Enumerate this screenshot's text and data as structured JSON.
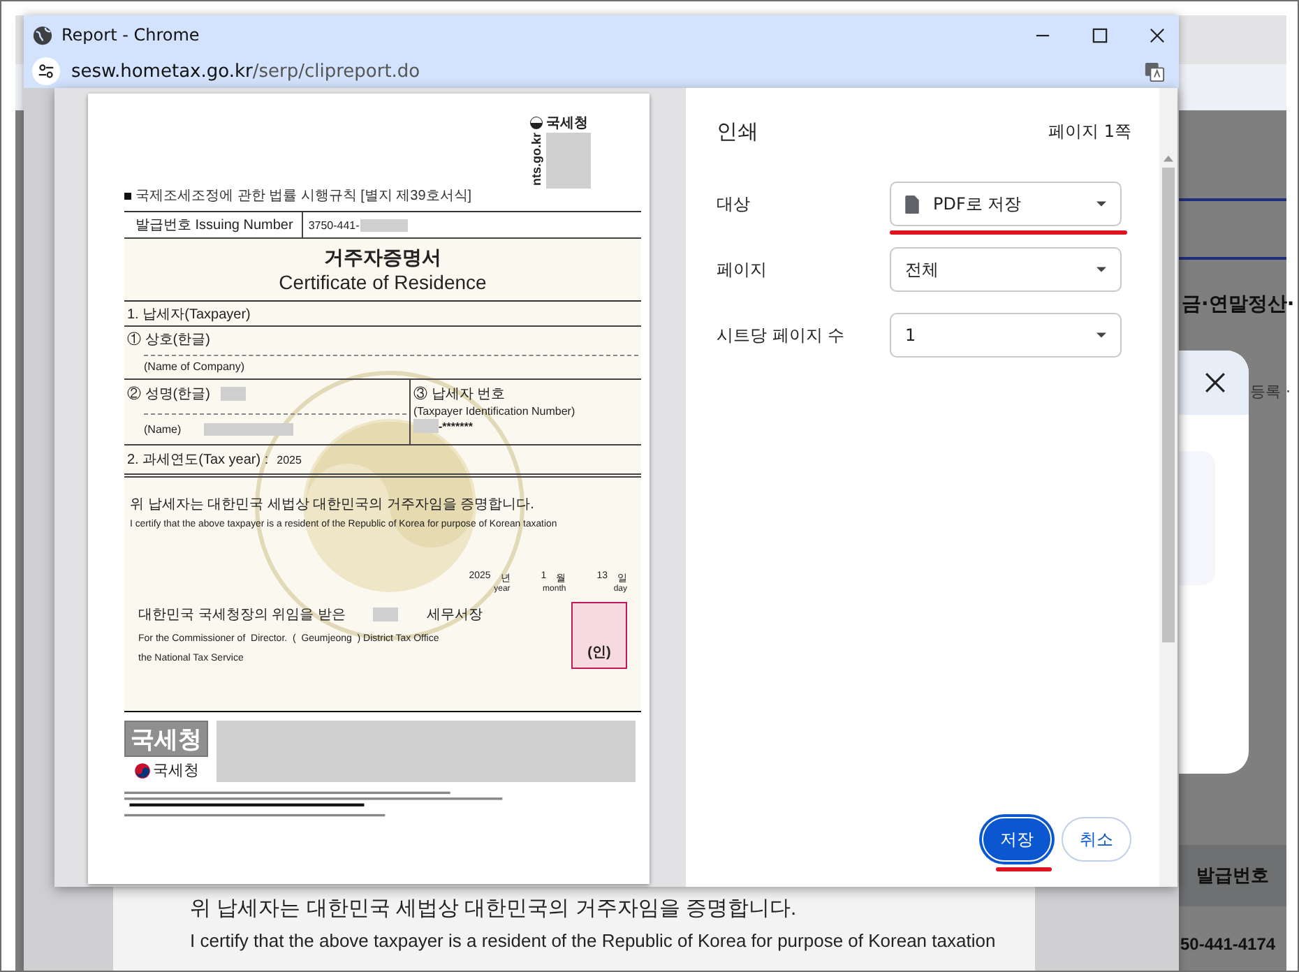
{
  "window": {
    "title": "Report - Chrome",
    "url_host": "sesw.hometax.go.kr",
    "url_path": "/serp/clipreport.do"
  },
  "document": {
    "agency_logo_text": "국세청",
    "site_text": "nts.go.kr",
    "form_reference": "국제조세조정에 관한 법률 시행규칙 [별지 제39호서식]",
    "issuing_label": "발급번호 Issuing Number",
    "issuing_number": "3750-441-",
    "title_ko": "거주자증명서",
    "title_en": "Certificate of Residence",
    "section_1": "1. 납세자(Taxpayer)",
    "company_label": "① 상호(한글)",
    "company_label_en": "(Name of Company)",
    "name_label": "② 성명(한글)",
    "name_label_en": "(Name)",
    "tin_label": "③ 납세자 번호",
    "tin_label_en": "(Taxpayer Identification Number)",
    "tin_value": "-*******",
    "section_2": "2. 과세연도(Tax year) :",
    "tax_year": "2025",
    "statement_ko": "위 납세자는 대한민국 세법상 대한민국의 거주자임을 증명합니다.",
    "statement_en": "I certify that the above taxpayer is a resident of the Republic of Korea for purpose of Korean taxation",
    "date": [
      {
        "value": "2025",
        "unit": "년",
        "unit_en": "year"
      },
      {
        "value": "1",
        "unit": "월",
        "unit_en": "month"
      },
      {
        "value": "13",
        "unit": "일",
        "unit_en": "day"
      }
    ],
    "delegation_ko": "대한민국 국세청장의 위임을 받은",
    "office_ko": "세무서장",
    "signatory_en": "For the Commissioner of  Director.  (  Geumjeong  ) District Tax Office",
    "signatory_en_2": "the National Tax Service",
    "seal_text": "(인)",
    "footer_stamp": "국세청",
    "footer_logo_text": "국세청"
  },
  "print_panel": {
    "title": "인쇄",
    "page_count": "페이지 1쪽",
    "settings": [
      {
        "label": "대상",
        "value": "PDF로 저장",
        "kind": "destination",
        "annotated": true
      },
      {
        "label": "페이지",
        "value": "전체",
        "kind": "select",
        "annotated": false
      },
      {
        "label": "시트당 페이지 수",
        "value": "1",
        "kind": "select",
        "annotated": false
      }
    ],
    "buttons": [
      {
        "label": "저장",
        "primary": true,
        "annotated": true
      },
      {
        "label": "취소",
        "primary": false,
        "annotated": false
      }
    ]
  },
  "background_page": {
    "heading_fragment": "금·연말정산·",
    "modal_text_fragment": "등록 ·",
    "table_header": "발급번호",
    "table_cell": "50-441-4174",
    "statement_ko": "위 납세자는 대한민국 세법상 대한민국의 거주자임을 증명합니다.",
    "statement_en": "I certify that the above taxpayer is a resident of the Republic of Korea for purpose of Korean taxation"
  }
}
